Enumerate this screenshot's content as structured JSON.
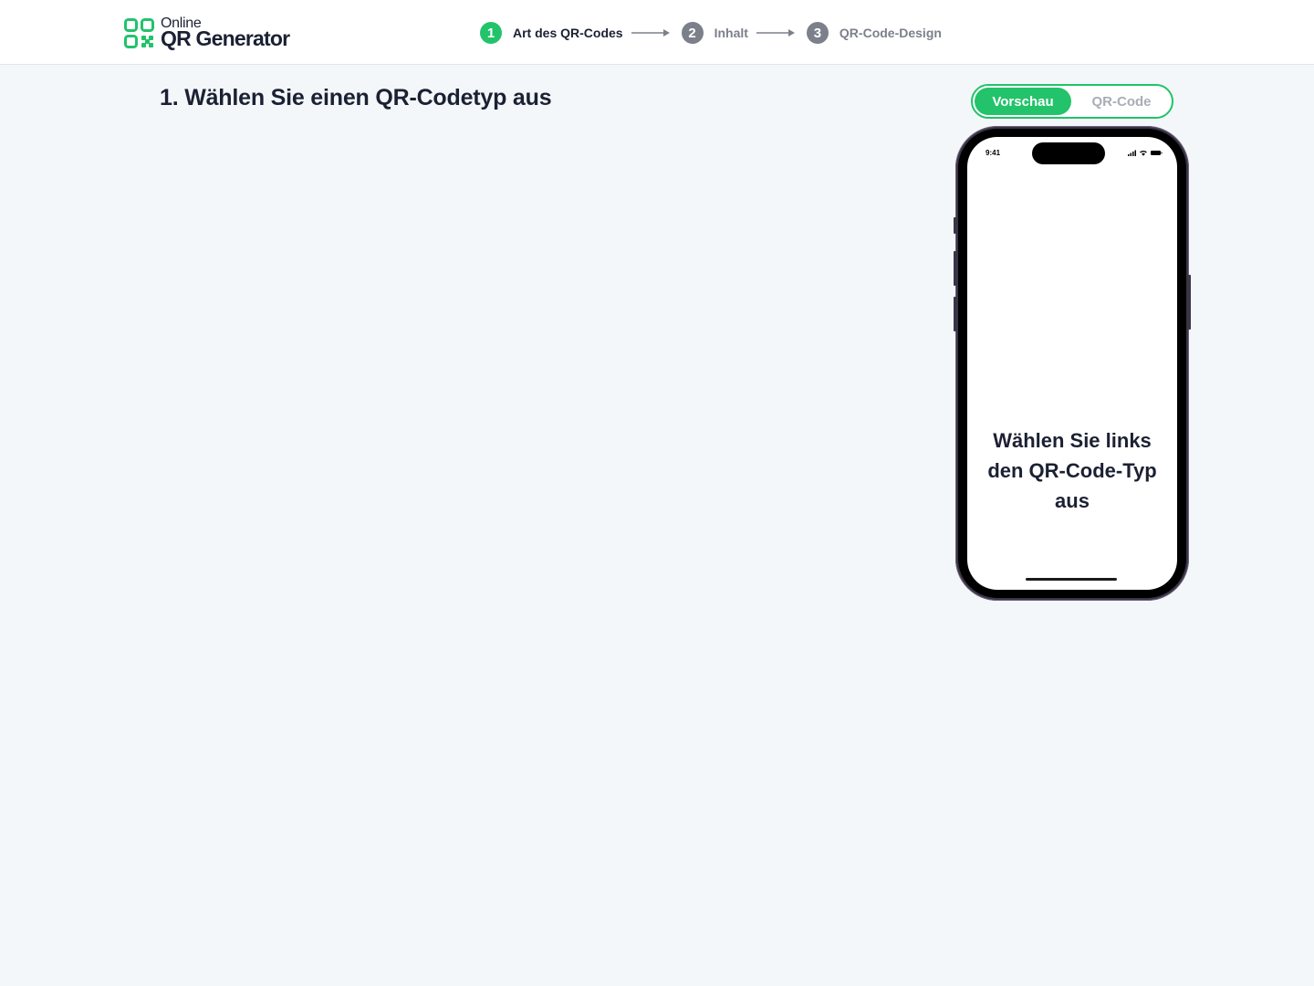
{
  "logo": {
    "line1": "Online",
    "line2": "QR Generator",
    "icon": "qr-logo-icon",
    "color": "#22c36a"
  },
  "steps": [
    {
      "number": "1",
      "label": "Art des QR-Codes",
      "active": true
    },
    {
      "number": "2",
      "label": "Inhalt",
      "active": false
    },
    {
      "number": "3",
      "label": "QR-Code-Design",
      "active": false
    }
  ],
  "main": {
    "title": "1. Wählen Sie einen QR-Codetyp aus"
  },
  "preview_toggle": {
    "options": [
      "Vorschau",
      "QR-Code"
    ],
    "selected": "Vorschau"
  },
  "phone": {
    "time": "9:41",
    "message": "Wählen Sie links den QR-Code-Typ aus"
  },
  "colors": {
    "accent": "#22c36a",
    "inactive_step": "#7c808b",
    "background": "#f3f7fa"
  }
}
